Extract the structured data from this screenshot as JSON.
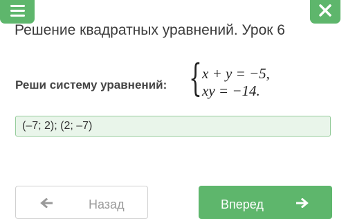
{
  "header": {
    "menu_icon": "hamburger-icon",
    "close_icon": "close-icon",
    "accent_color": "#5eb66c"
  },
  "lesson": {
    "title": "Решение квадратных уравнений. Урок 6"
  },
  "task": {
    "label": "Реши систему уравнений:",
    "equation_1": "x + y = −5,",
    "equation_2": "xy = −14."
  },
  "answer": {
    "value": "(–7; 2); (2; –7)",
    "status_color": "#e9f5ea"
  },
  "navigation": {
    "back_label": "Назад",
    "back_icon": "arrow-left-icon",
    "forward_label": "Вперед",
    "forward_icon": "arrow-right-icon"
  }
}
